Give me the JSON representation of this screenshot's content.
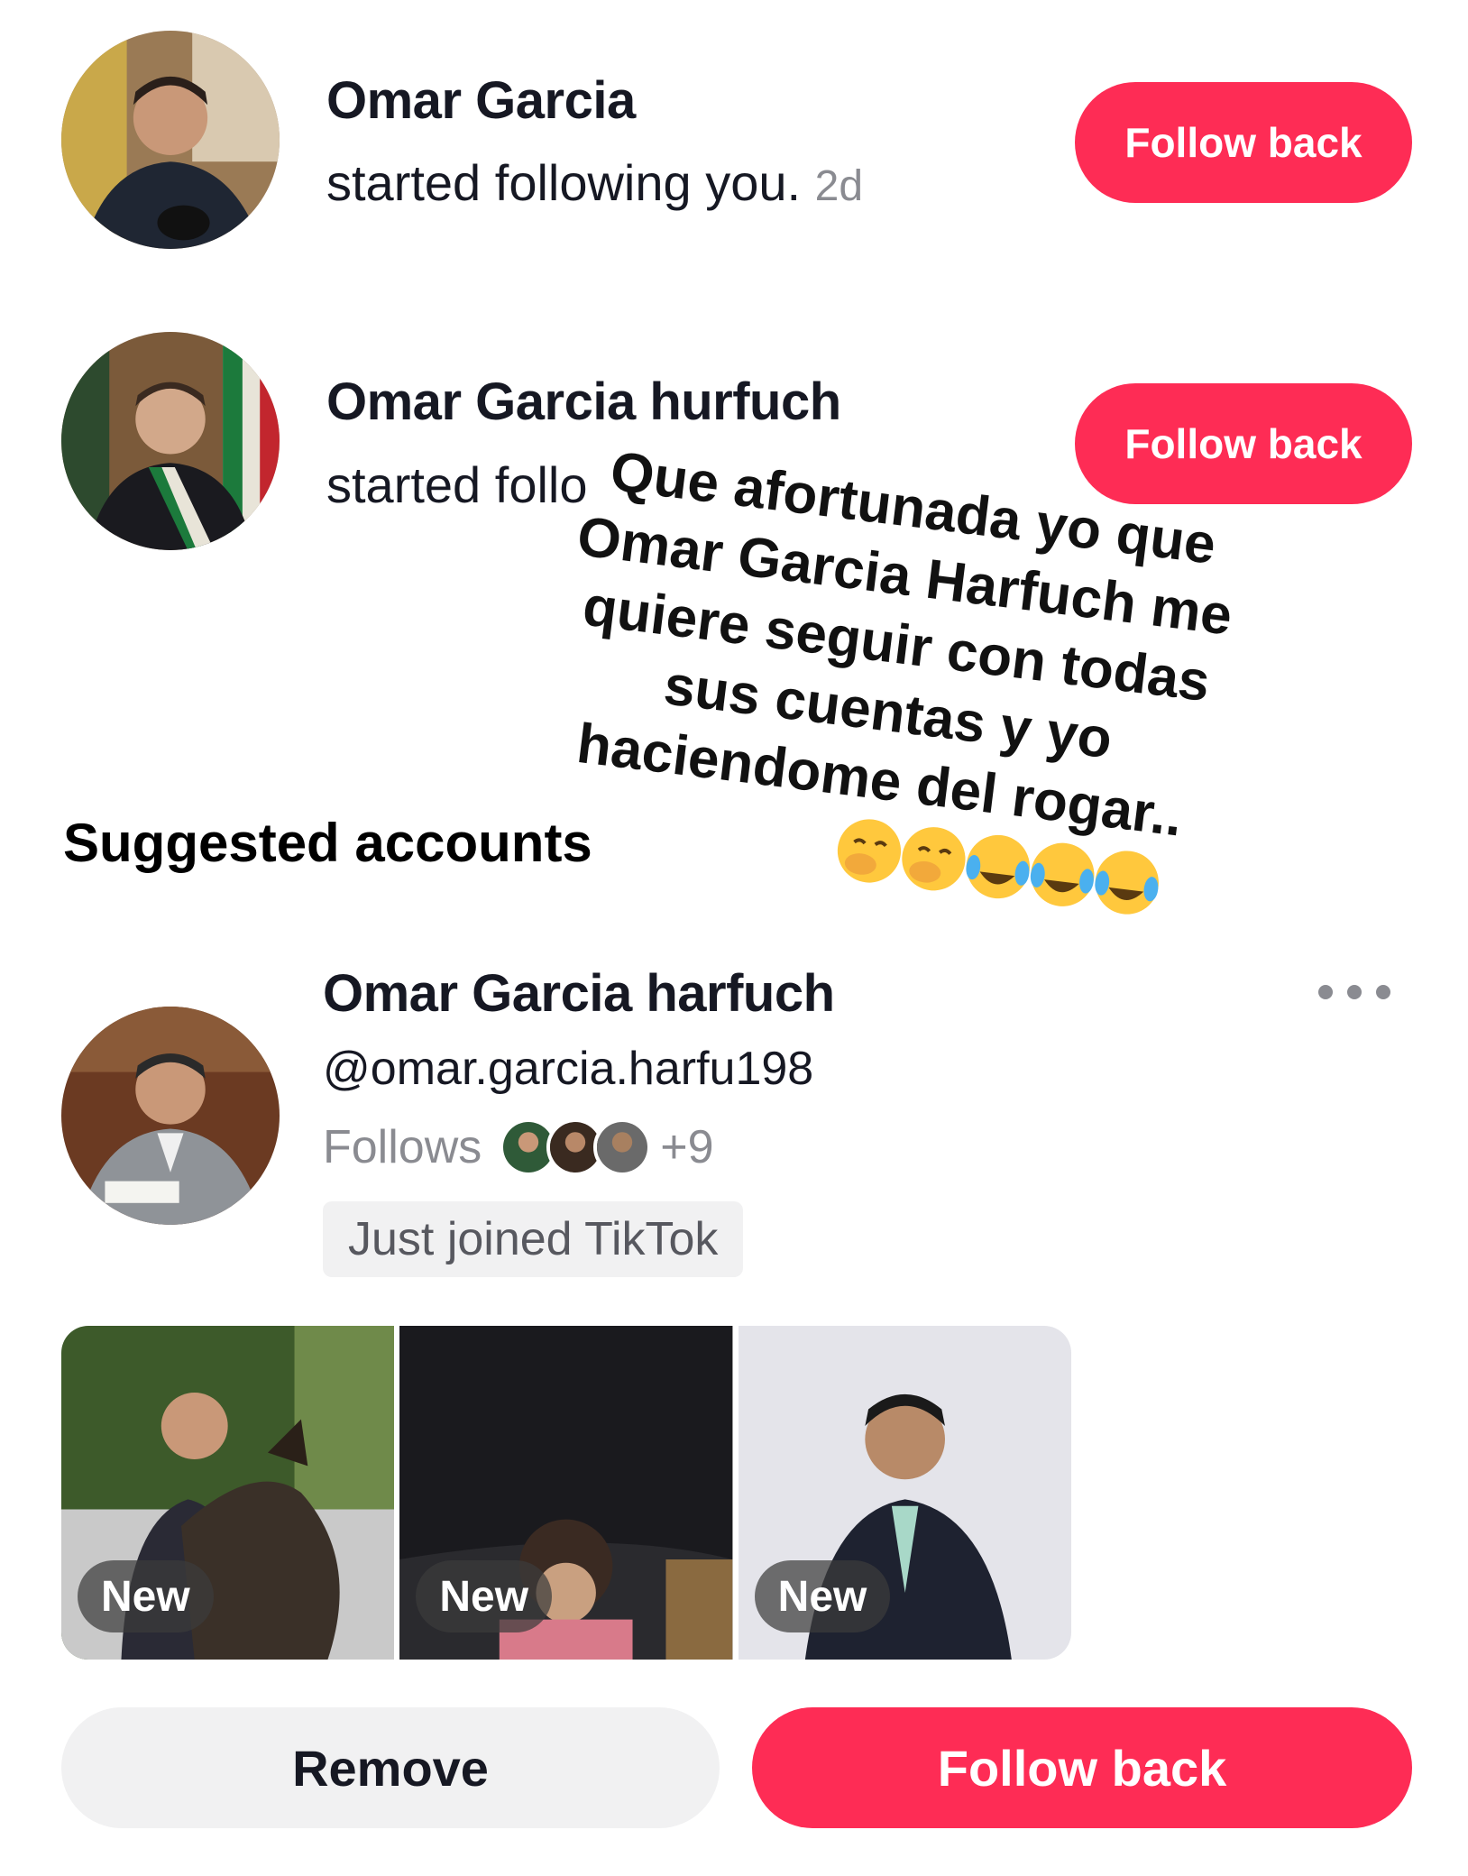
{
  "notifications": [
    {
      "name": "Omar Garcia",
      "action": "started following you.",
      "time": "2d",
      "button": "Follow back"
    },
    {
      "name": "Omar Garcia hurfuch",
      "action": "started follo",
      "button": "Follow back"
    }
  ],
  "overlay_text": "Que afortunada yo que Omar Garcia Harfuch me quiere seguir con todas sus cuentas y yo haciendome del rogar..",
  "suggested": {
    "section_title": "Suggested accounts",
    "name": "Omar Garcia harfuch",
    "handle": "@omar.garcia.harfu198",
    "follows_label": "Follows",
    "follows_more": "+9",
    "badge": "Just joined TikTok",
    "thumbnails": [
      {
        "badge": "New"
      },
      {
        "badge": "New"
      },
      {
        "badge": "New"
      }
    ],
    "remove_label": "Remove",
    "follow_label": "Follow back"
  },
  "colors": {
    "accent": "#fe2c55",
    "secondary_bg": "#f1f1f2",
    "muted_text": "#8a8b91"
  }
}
